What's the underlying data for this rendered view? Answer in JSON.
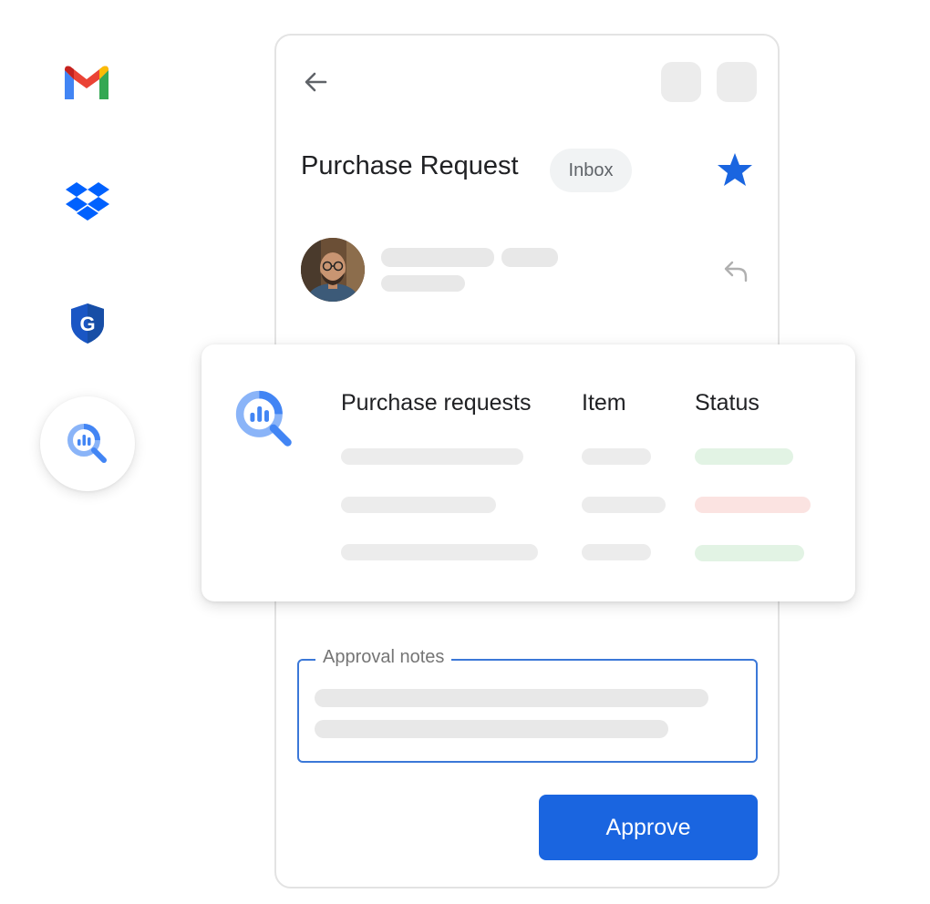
{
  "sidebar": {
    "apps": [
      {
        "icon": "gmail-icon"
      },
      {
        "icon": "dropbox-icon"
      },
      {
        "icon": "google-shield-icon"
      },
      {
        "icon": "bigquery-icon",
        "selected": true
      }
    ]
  },
  "email": {
    "subject": "Purchase Request",
    "label_chip": "Inbox",
    "starred": true
  },
  "table_card": {
    "columns": [
      "Purchase requests",
      "Item",
      "Status"
    ],
    "rows": [
      {
        "status": "approved"
      },
      {
        "status": "rejected"
      },
      {
        "status": "approved"
      }
    ],
    "colors": {
      "approved": "#e2f3e4",
      "rejected": "#fbe3e1"
    }
  },
  "notes": {
    "label": "Approval notes"
  },
  "actions": {
    "approve_label": "Approve"
  },
  "colors": {
    "accent": "#1a65e0",
    "star": "#1a65e0",
    "notes_border": "#3b78d8"
  }
}
